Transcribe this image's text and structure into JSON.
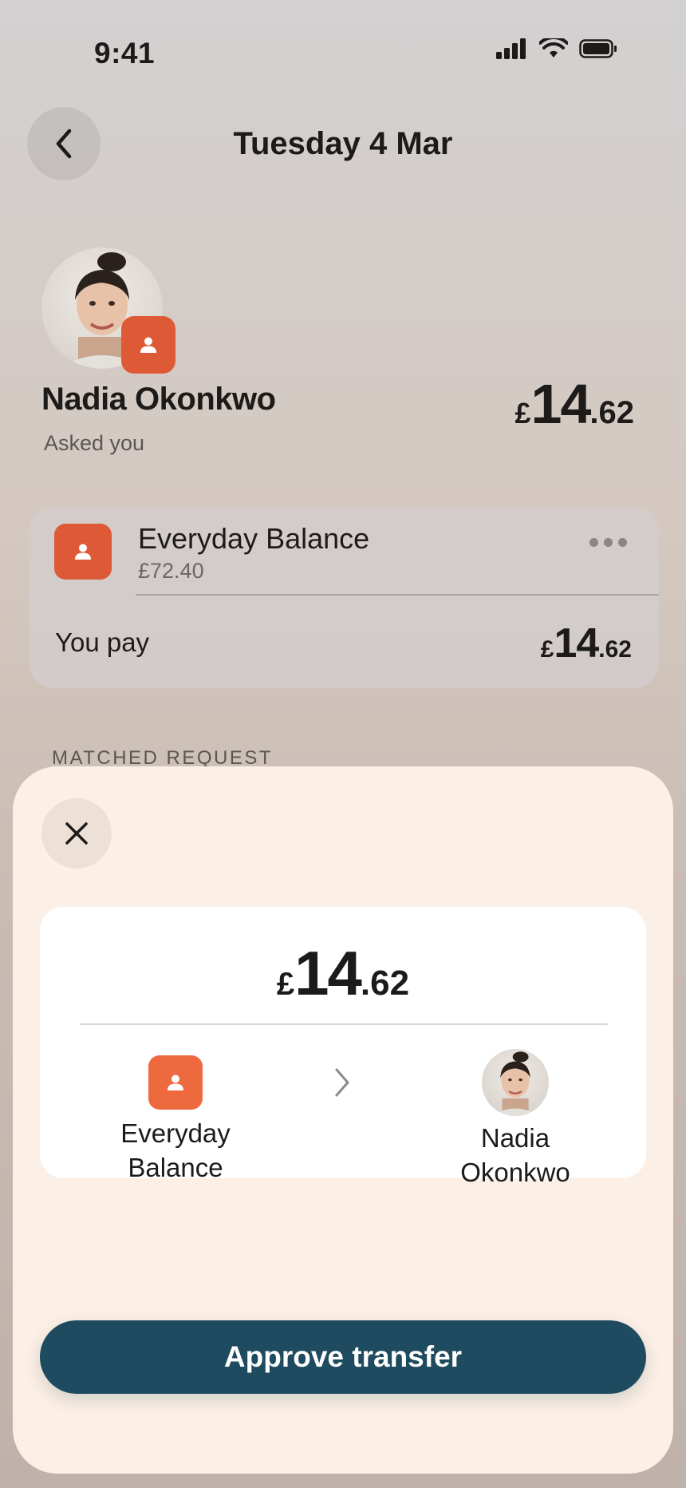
{
  "status_bar": {
    "time": "9:41"
  },
  "header": {
    "title": "Tuesday 4 Mar"
  },
  "request": {
    "name": "Nadia Okonkwo",
    "status": "Asked you",
    "amount": {
      "currency": "£",
      "integer": "14",
      "decimal": ".62"
    }
  },
  "source_card": {
    "account_name": "Everyday Balance",
    "account_balance": "£72.40",
    "pay_label": "You pay",
    "pay_amount": {
      "currency": "£",
      "integer": "14",
      "decimal": ".62"
    }
  },
  "section": {
    "label": "MATCHED REQUEST"
  },
  "sheet": {
    "amount": {
      "currency": "£",
      "integer": "14",
      "decimal": ".62"
    },
    "from": {
      "line1": "Everyday",
      "line2": "Balance"
    },
    "to": {
      "line1": "Nadia",
      "line2": "Okonkwo"
    },
    "approve_label": "Approve transfer"
  },
  "colors": {
    "accent_orange": "#de5a36",
    "button_teal": "#1e4b5f",
    "sheet_bg": "#fcefe5"
  },
  "icons": [
    "back-chevron-icon",
    "signal-icon",
    "wifi-icon",
    "battery-icon",
    "person-icon",
    "more-icon",
    "close-icon",
    "chevron-right-icon"
  ]
}
